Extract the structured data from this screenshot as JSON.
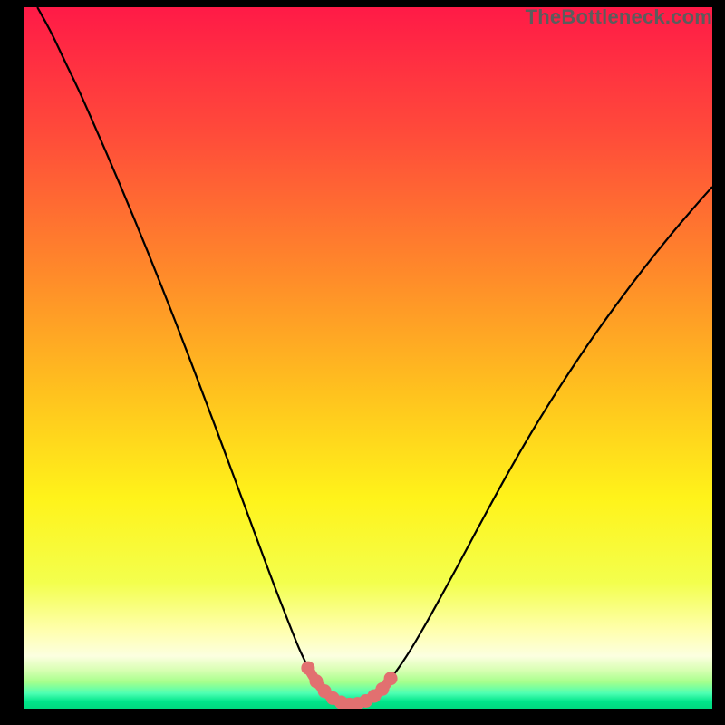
{
  "watermark": "TheBottleneck.com",
  "colors": {
    "frame": "#000000",
    "curve": "#000000",
    "marker_fill": "#e27070",
    "marker_stroke": "#c94f50",
    "gradient_stops": [
      {
        "offset": 0.0,
        "color": "#ff1a47"
      },
      {
        "offset": 0.18,
        "color": "#ff4b3a"
      },
      {
        "offset": 0.38,
        "color": "#ff8a2a"
      },
      {
        "offset": 0.55,
        "color": "#ffc21e"
      },
      {
        "offset": 0.7,
        "color": "#fff31a"
      },
      {
        "offset": 0.82,
        "color": "#f3ff4d"
      },
      {
        "offset": 0.89,
        "color": "#ffffb0"
      },
      {
        "offset": 0.925,
        "color": "#fcffe0"
      },
      {
        "offset": 0.945,
        "color": "#d8ffb3"
      },
      {
        "offset": 0.962,
        "color": "#a6ff8c"
      },
      {
        "offset": 0.978,
        "color": "#4dffb3"
      },
      {
        "offset": 0.99,
        "color": "#00e58a"
      },
      {
        "offset": 1.0,
        "color": "#00d97f"
      }
    ]
  },
  "chart_data": {
    "type": "line",
    "title": "",
    "xlabel": "",
    "ylabel": "",
    "xlim": [
      0,
      100
    ],
    "ylim": [
      0,
      100
    ],
    "grid": false,
    "legend": false,
    "series": [
      {
        "name": "bottleneck-curve",
        "x": [
          2,
          4,
          6,
          8,
          10,
          12,
          14,
          16,
          18,
          20,
          22,
          24,
          26,
          28,
          30,
          32,
          33.5,
          35,
          36.5,
          38,
          39,
          40,
          41,
          42,
          43,
          44,
          45,
          46,
          47,
          48,
          49,
          50,
          51,
          52,
          54,
          56,
          58,
          60,
          63,
          66,
          70,
          74,
          78,
          82,
          86,
          90,
          94,
          98,
          100
        ],
        "y": [
          100,
          96.4,
          92.3,
          88.2,
          83.8,
          79.3,
          74.7,
          70.0,
          65.2,
          60.3,
          55.3,
          50.2,
          45.0,
          39.8,
          34.5,
          29.2,
          25.2,
          21.2,
          17.3,
          13.5,
          11.0,
          8.6,
          6.5,
          4.6,
          3.1,
          2.0,
          1.2,
          0.7,
          0.4,
          0.4,
          0.7,
          1.2,
          1.9,
          2.8,
          5.2,
          8.1,
          11.4,
          14.9,
          20.3,
          25.8,
          33.0,
          39.8,
          46.1,
          52.0,
          57.5,
          62.7,
          67.6,
          72.2,
          74.4
        ]
      }
    ],
    "markers": {
      "name": "valley-markers",
      "x": [
        41.3,
        42.5,
        43.7,
        44.9,
        46.1,
        47.3,
        48.5,
        49.7,
        50.9,
        52.1,
        53.3
      ],
      "y": [
        5.8,
        3.9,
        2.5,
        1.5,
        0.9,
        0.6,
        0.7,
        1.1,
        1.8,
        2.8,
        4.3
      ]
    }
  }
}
